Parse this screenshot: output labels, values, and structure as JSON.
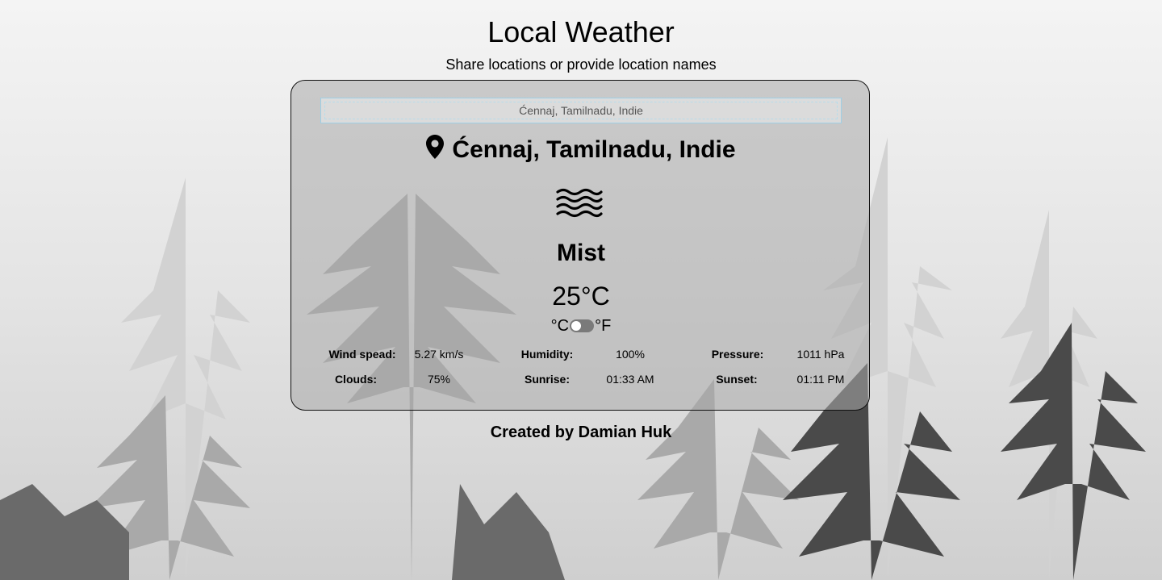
{
  "header": {
    "title": "Local Weather",
    "subtitle": "Share locations or provide location names"
  },
  "search": {
    "value": "Ćennaj, Tamilnadu, Indie"
  },
  "location": {
    "name": "Ćennaj, Tamilnadu, Indie",
    "icon": "map-pin-icon"
  },
  "weather": {
    "icon": "mist-icon",
    "description": "Mist",
    "temperature": "25°C",
    "unit_celsius": "°C",
    "unit_fahrenheit": "°F",
    "unit_toggle_state": "celsius"
  },
  "details": {
    "row1": [
      {
        "label": "Wind spead:",
        "value": "5.27 km/s"
      },
      {
        "label": "Humidity:",
        "value": "100%"
      },
      {
        "label": "Pressure:",
        "value": "1011 hPa"
      }
    ],
    "row2": [
      {
        "label": "Clouds:",
        "value": "75%"
      },
      {
        "label": "Sunrise:",
        "value": "01:33 AM"
      },
      {
        "label": "Sunset:",
        "value": "01:11 PM"
      }
    ]
  },
  "footer": {
    "credit": "Created by Damian Huk"
  },
  "colors": {
    "card_border": "#111111",
    "search_border": "#9fd0e6",
    "toggle_track": "#7a7a7a"
  }
}
